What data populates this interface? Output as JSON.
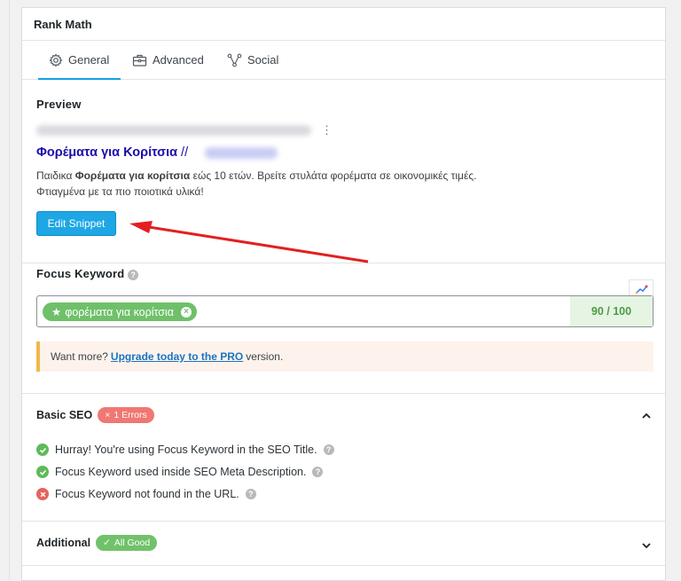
{
  "panel": {
    "title": "Rank Math",
    "tabs": [
      {
        "label": "General",
        "icon": "gear-icon"
      },
      {
        "label": "Advanced",
        "icon": "briefcase-icon"
      },
      {
        "label": "Social",
        "icon": "share-nodes-icon"
      }
    ]
  },
  "preview": {
    "label": "Preview",
    "title_main": "Φορέματα για Κορίτσια",
    "title_sep": " // ",
    "description_bold_lead": "Παιδικα ",
    "description_bold": "Φορέματα για κορίτσια",
    "description_rest": " εώς 10 ετών. Βρείτε στυλάτα φορέματα σε οικονομικές τιμές.",
    "description_line2": "Φτιαγμένα με τα πιο ποιοτικά υλικά!",
    "edit_button": "Edit Snippet"
  },
  "focus_keyword": {
    "label": "Focus Keyword",
    "keyword": "φορέματα για κορίτσια",
    "score": "90 / 100"
  },
  "notice": {
    "prefix": "Want more?",
    "link": "Upgrade today to the PRO",
    "suffix": "version."
  },
  "basic_seo": {
    "label": "Basic SEO",
    "badge": "1 Errors",
    "checks": [
      {
        "text": "Hurray! You're using Focus Keyword in the SEO Title.",
        "status": "ok"
      },
      {
        "text": "Focus Keyword used inside SEO Meta Description.",
        "status": "ok"
      },
      {
        "text": "Focus Keyword not found in the URL.",
        "status": "error"
      }
    ]
  },
  "additional": {
    "label": "Additional",
    "badge": "All Good"
  },
  "colors": {
    "accent": "#10a2e0",
    "button": "#1ea7e4",
    "ok": "#5fb95a",
    "error": "#e6635e",
    "arrow": "#e31f1f"
  }
}
